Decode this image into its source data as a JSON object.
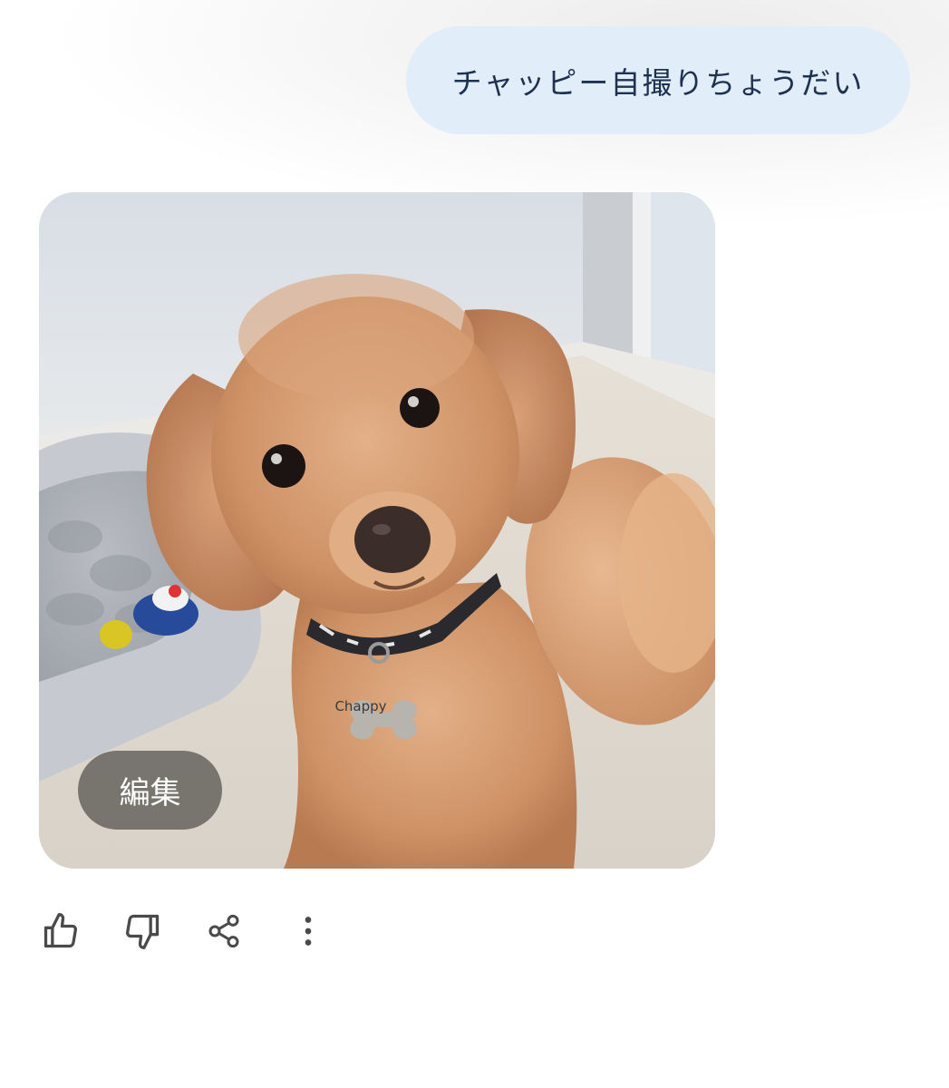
{
  "conversation": {
    "user_message": "チャッピー自撮りちょうだい",
    "response": {
      "image": {
        "icon": "dog-selfie-photo",
        "tag_text": "Chappy"
      },
      "edit_label": "編集"
    }
  },
  "actions": [
    {
      "name": "thumbs-up",
      "icon": "thumbs-up-icon"
    },
    {
      "name": "thumbs-down",
      "icon": "thumbs-down-icon"
    },
    {
      "name": "share",
      "icon": "share-icon"
    },
    {
      "name": "more",
      "icon": "more-vertical-icon"
    }
  ],
  "colors": {
    "user_bubble": "#e1edf9",
    "user_text": "#1f3150",
    "icon": "#4a4a4a",
    "edit_button": "#5c5854"
  }
}
